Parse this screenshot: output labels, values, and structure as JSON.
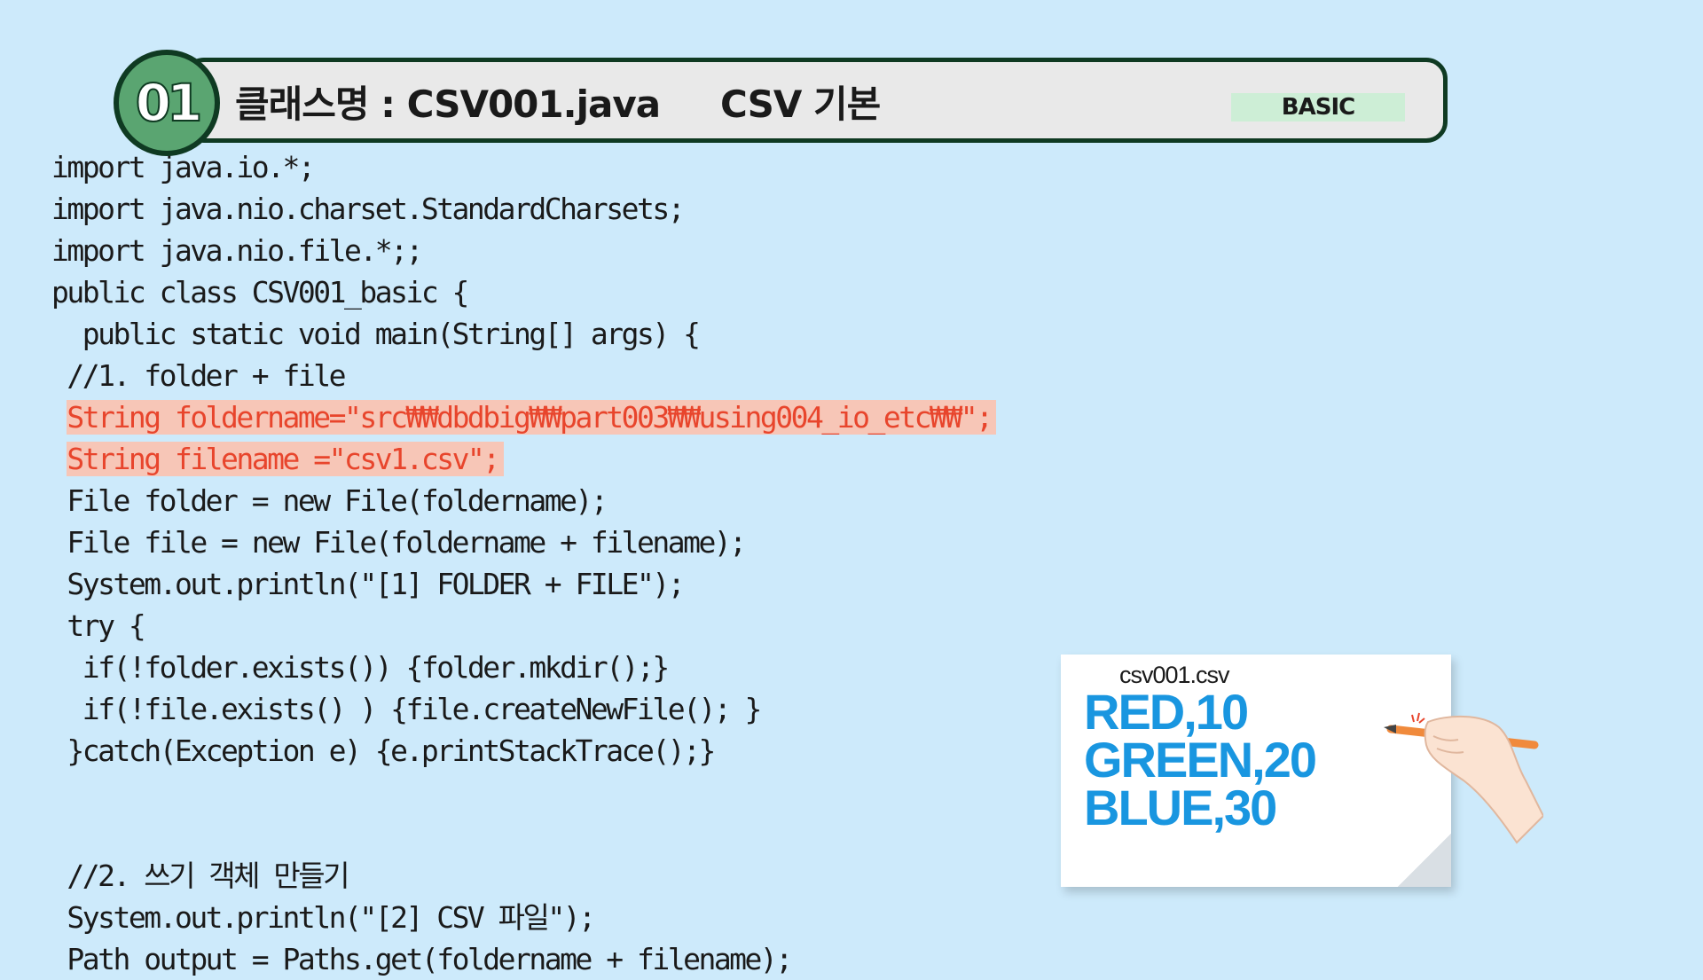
{
  "header": {
    "number": "01",
    "class_title": "클래스명 : CSV001.java",
    "lesson_title": "CSV 기본",
    "level": "BASIC"
  },
  "code_lines": [
    {
      "indent": "",
      "text": "import java.io.*;",
      "highlight": false
    },
    {
      "indent": "",
      "text": "import java.nio.charset.StandardCharsets;",
      "highlight": false
    },
    {
      "indent": "",
      "text": "import java.nio.file.*;;",
      "highlight": false
    },
    {
      "indent": "",
      "text": "public class CSV001_basic {",
      "highlight": false
    },
    {
      "indent": "  ",
      "text": "public static void main(String[] args) {",
      "highlight": false
    },
    {
      "indent": " ",
      "text": "//1. folder + file",
      "highlight": false
    },
    {
      "indent": " ",
      "text": "String foldername=\"src₩₩dbdbig₩₩part003₩₩using004_io_etc₩₩\";",
      "highlight": true
    },
    {
      "indent": " ",
      "text": "String filename =\"csv1.csv\";",
      "highlight": true
    },
    {
      "indent": " ",
      "text": "File folder = new File(foldername);",
      "highlight": false
    },
    {
      "indent": " ",
      "text": "File file = new File(foldername + filename);",
      "highlight": false
    },
    {
      "indent": " ",
      "text": "System.out.println(\"[1] FOLDER + FILE\");",
      "highlight": false
    },
    {
      "indent": " ",
      "text": "try {",
      "highlight": false
    },
    {
      "indent": "  ",
      "text": "if(!folder.exists()) {folder.mkdir();}",
      "highlight": false
    },
    {
      "indent": "  ",
      "text": "if(!file.exists() ) {file.createNewFile(); }",
      "highlight": false
    },
    {
      "indent": " ",
      "text": "}catch(Exception e) {e.printStackTrace();}",
      "highlight": false
    },
    {
      "indent": "",
      "text": "",
      "highlight": false
    },
    {
      "indent": "",
      "text": "",
      "highlight": false
    },
    {
      "indent": " ",
      "text": "//2. 쓰기 객체 만들기",
      "highlight": false
    },
    {
      "indent": " ",
      "text": "System.out.println(\"[2] CSV 파일\");",
      "highlight": false
    },
    {
      "indent": " ",
      "text": "Path output = Paths.get(foldername + filename);",
      "highlight": false
    }
  ],
  "paper": {
    "filename": "csv001.csv",
    "lines": [
      "RED,10",
      "GREEN,20",
      "BLUE,30"
    ],
    "text_color": "#1996e0"
  },
  "colors": {
    "background": "#cdeafb",
    "highlight_bg": "#f7c6b7",
    "highlight_text": "#e8452c",
    "badge_green": "#5aa571",
    "level_bg": "#cdeed6"
  }
}
